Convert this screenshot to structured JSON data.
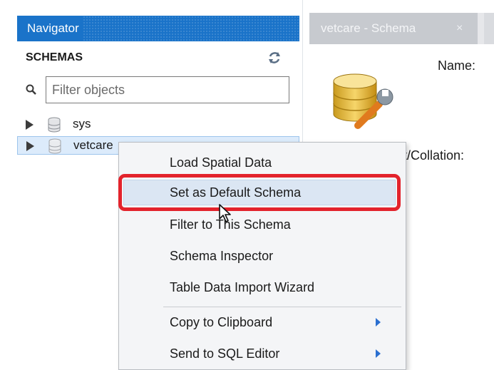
{
  "navigator": {
    "title": "Navigator",
    "schemas_title": "SCHEMAS",
    "filter_placeholder": "Filter objects",
    "schemas": [
      {
        "label": "sys"
      },
      {
        "label": "vetcare"
      }
    ]
  },
  "editor": {
    "tab_label": "vetcare - Schema",
    "tab_close": "×",
    "name_label": "Name:",
    "charset_label": "et/Collation:"
  },
  "context_menu": {
    "items": [
      {
        "label": "Load Spatial Data"
      },
      {
        "label": "Set as Default Schema"
      },
      {
        "label": "Filter to This Schema"
      },
      {
        "label": "Schema Inspector"
      },
      {
        "label": "Table Data Import Wizard"
      },
      {
        "label": "Copy to Clipboard"
      },
      {
        "label": "Send to SQL Editor"
      }
    ]
  },
  "colors": {
    "navigator_header": "#1a73c9",
    "highlight_box": "#e3232c",
    "selected_row": "#dcebfb",
    "submenu_arrow": "#2b6fd0"
  }
}
